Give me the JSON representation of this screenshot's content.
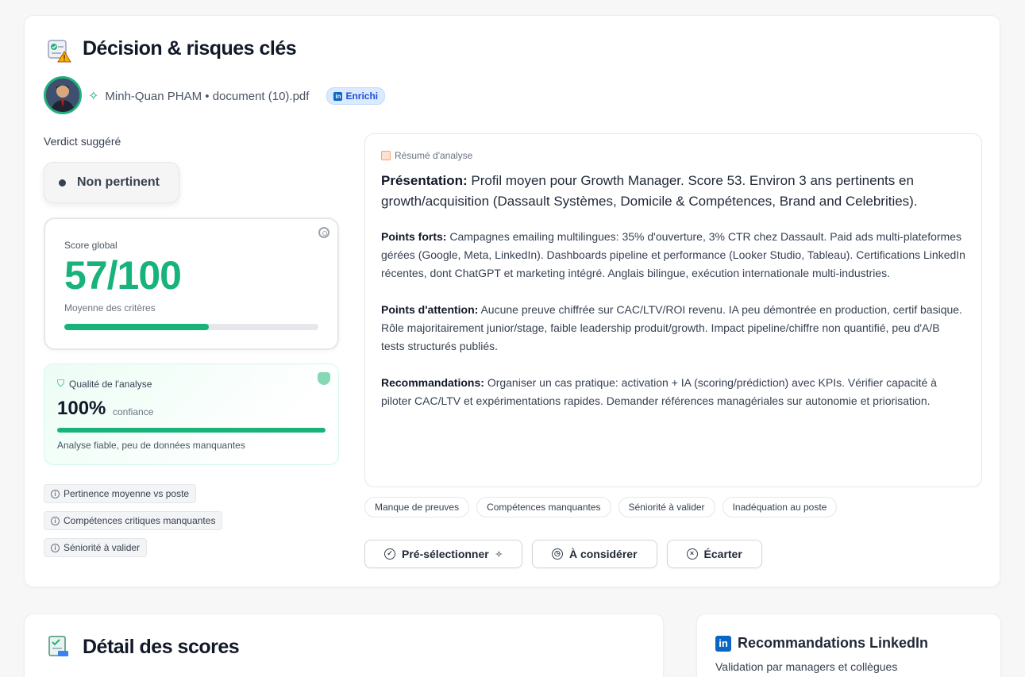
{
  "header": {
    "title": "Décision & risques clés"
  },
  "candidate": {
    "meta": "Minh-Quan PHAM • document (10).pdf",
    "enriched_label": "Enrichi"
  },
  "verdict": {
    "label": "Verdict suggéré",
    "value": "Non pertinent"
  },
  "score": {
    "label": "Score global",
    "value": "57/100",
    "progress": 0.57,
    "subtitle": "Moyenne des critères"
  },
  "quality": {
    "title": "Qualité de l'analyse",
    "value": "100%",
    "unit": "confiance",
    "progress": 1.0,
    "note": "Analyse fiable, peu de données manquantes"
  },
  "flags": [
    "Pertinence moyenne vs poste",
    "Compétences critiques manquantes",
    "Séniorité à valider"
  ],
  "summary": {
    "heading": "Résumé d'analyse",
    "presentation_label": "Présentation:",
    "presentation": "Profil moyen pour Growth Manager. Score 53. Environ 3 ans pertinents en growth/acquisition (Dassault Systèmes, Domicile & Compétences, Brand and Celebrities).",
    "strengths_label": "Points forts:",
    "strengths": "Campagnes emailing multilingues: 35% d'ouverture, 3% CTR chez Dassault. Paid ads multi-plateformes gérées (Google, Meta, LinkedIn). Dashboards pipeline et performance (Looker Studio, Tableau). Certifications LinkedIn récentes, dont ChatGPT et marketing intégré. Anglais bilingue, exécution internationale multi-industries.",
    "attention_label": "Points d'attention:",
    "attention": "Aucune preuve chiffrée sur CAC/LTV/ROI revenu. IA peu démontrée en production, certif basique. Rôle majoritairement junior/stage, faible leadership produit/growth. Impact pipeline/chiffre non quantifié, peu d'A/B tests structurés publiés.",
    "reco_label": "Recommandations:",
    "reco": "Organiser un cas pratique: activation + IA (scoring/prédiction) avec KPIs. Vérifier capacité à piloter CAC/LTV et expérimentations rapides. Demander références managériales sur autonomie et priorisation."
  },
  "tags": [
    "Manque de preuves",
    "Compétences manquantes",
    "Séniorité à valider",
    "Inadéquation au poste"
  ],
  "actions": {
    "preselect": "Pré-sélectionner",
    "consider": "À considérer",
    "reject": "Écarter"
  },
  "detail": {
    "title": "Détail des scores"
  },
  "linkedin": {
    "title": "Recommandations LinkedIn",
    "subtitle": "Validation par managers et collègues"
  },
  "colors": {
    "accent": "#17b37b",
    "linkedin": "#0a66c2"
  }
}
